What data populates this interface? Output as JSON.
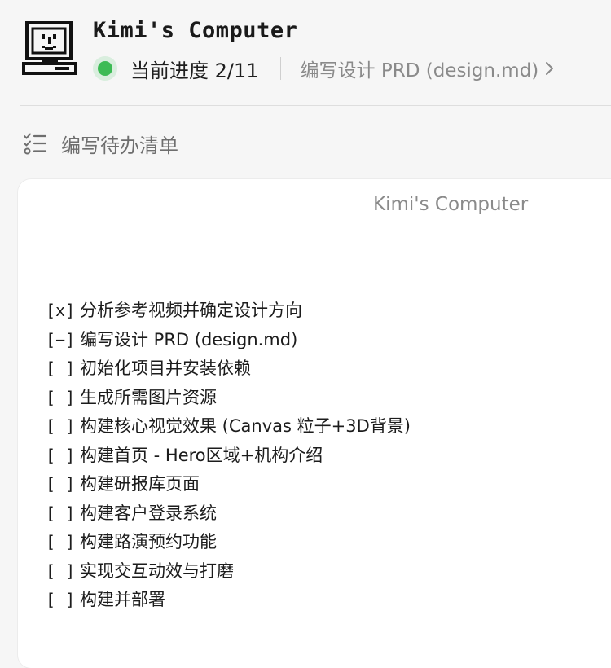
{
  "header": {
    "app_title": "Kimi's Computer",
    "progress_text": "当前进度 2/11",
    "current_step": "编写设计 PRD (design.md)",
    "status_color": "#3dbb55"
  },
  "section": {
    "label": "编写待办清单",
    "icon": "checklist-icon"
  },
  "card": {
    "title": "Kimi's Computer"
  },
  "todos": [
    {
      "check": "[x]",
      "text": "分析参考视频并确定设计方向"
    },
    {
      "check": "[−]",
      "text": "编写设计 PRD (design.md)"
    },
    {
      "check": "[ ]",
      "text": "初始化项目并安装依赖"
    },
    {
      "check": "[ ]",
      "text": "生成所需图片资源"
    },
    {
      "check": "[ ]",
      "text": "构建核心视觉效果 (Canvas 粒子+3D背景)"
    },
    {
      "check": "[ ]",
      "text": "构建首页 - Hero区域+机构介绍"
    },
    {
      "check": "[ ]",
      "text": "构建研报库页面"
    },
    {
      "check": "[ ]",
      "text": "构建客户登录系统"
    },
    {
      "check": "[ ]",
      "text": "构建路演预约功能"
    },
    {
      "check": "[ ]",
      "text": "实现交互动效与打磨"
    },
    {
      "check": "[ ]",
      "text": "构建并部署"
    }
  ]
}
